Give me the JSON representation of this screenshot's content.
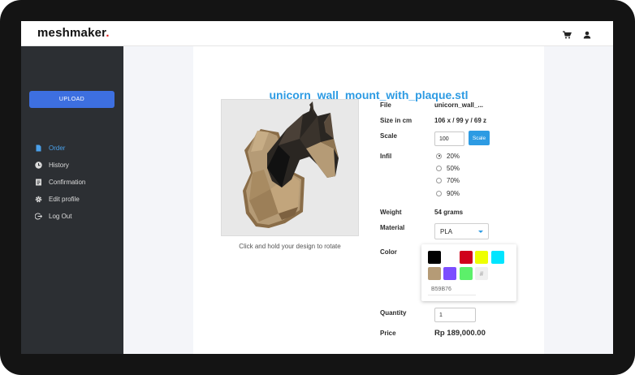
{
  "app": {
    "logo_text": "meshmaker",
    "logo_dot": ".",
    "logo_dot_color": "#e0221f",
    "accent_color": "#2d9be3"
  },
  "header": {
    "icons": [
      "cart-icon",
      "user-icon"
    ]
  },
  "sidebar": {
    "upload_label": "UPLOAD",
    "items": [
      {
        "label": "Order",
        "icon": "file-icon",
        "active": true
      },
      {
        "label": "History",
        "icon": "clock-icon",
        "active": false
      },
      {
        "label": "Confirmation",
        "icon": "document-icon",
        "active": false
      },
      {
        "label": "Edit profile",
        "icon": "gear-icon",
        "active": false
      },
      {
        "label": "Log Out",
        "icon": "logout-icon",
        "active": false
      }
    ]
  },
  "order": {
    "file_title": "unicorn_wall_mount_with_plaque.stl",
    "preview_hint": "Click and hold your design to rotate",
    "labels": {
      "file": "File",
      "size": "Size in cm",
      "scale": "Scale",
      "infill": "Infil",
      "weight": "Weight",
      "material": "Material",
      "color": "Color",
      "quantity": "Quantity",
      "price": "Price"
    },
    "file_value": "unicorn_wall_...",
    "size_value": "106 x / 99 y / 69 z",
    "scale_value": "100",
    "scale_button": "Scale",
    "infill_options": [
      {
        "label": "20%",
        "selected": true
      },
      {
        "label": "50%",
        "selected": false
      },
      {
        "label": "70%",
        "selected": false
      },
      {
        "label": "90%",
        "selected": false
      }
    ],
    "weight_value": "54 grams",
    "material_value": "PLA",
    "color_swatches": [
      "#000000",
      "#ffffff",
      "#d0021b",
      "#eeff00",
      "#00e5ff",
      "#b59b76",
      "#7c4dff",
      "#5cf06a"
    ],
    "hash_label": "#",
    "hex_value": "B59B76",
    "quantity_value": "1",
    "price_value": "Rp 189,000.00"
  }
}
